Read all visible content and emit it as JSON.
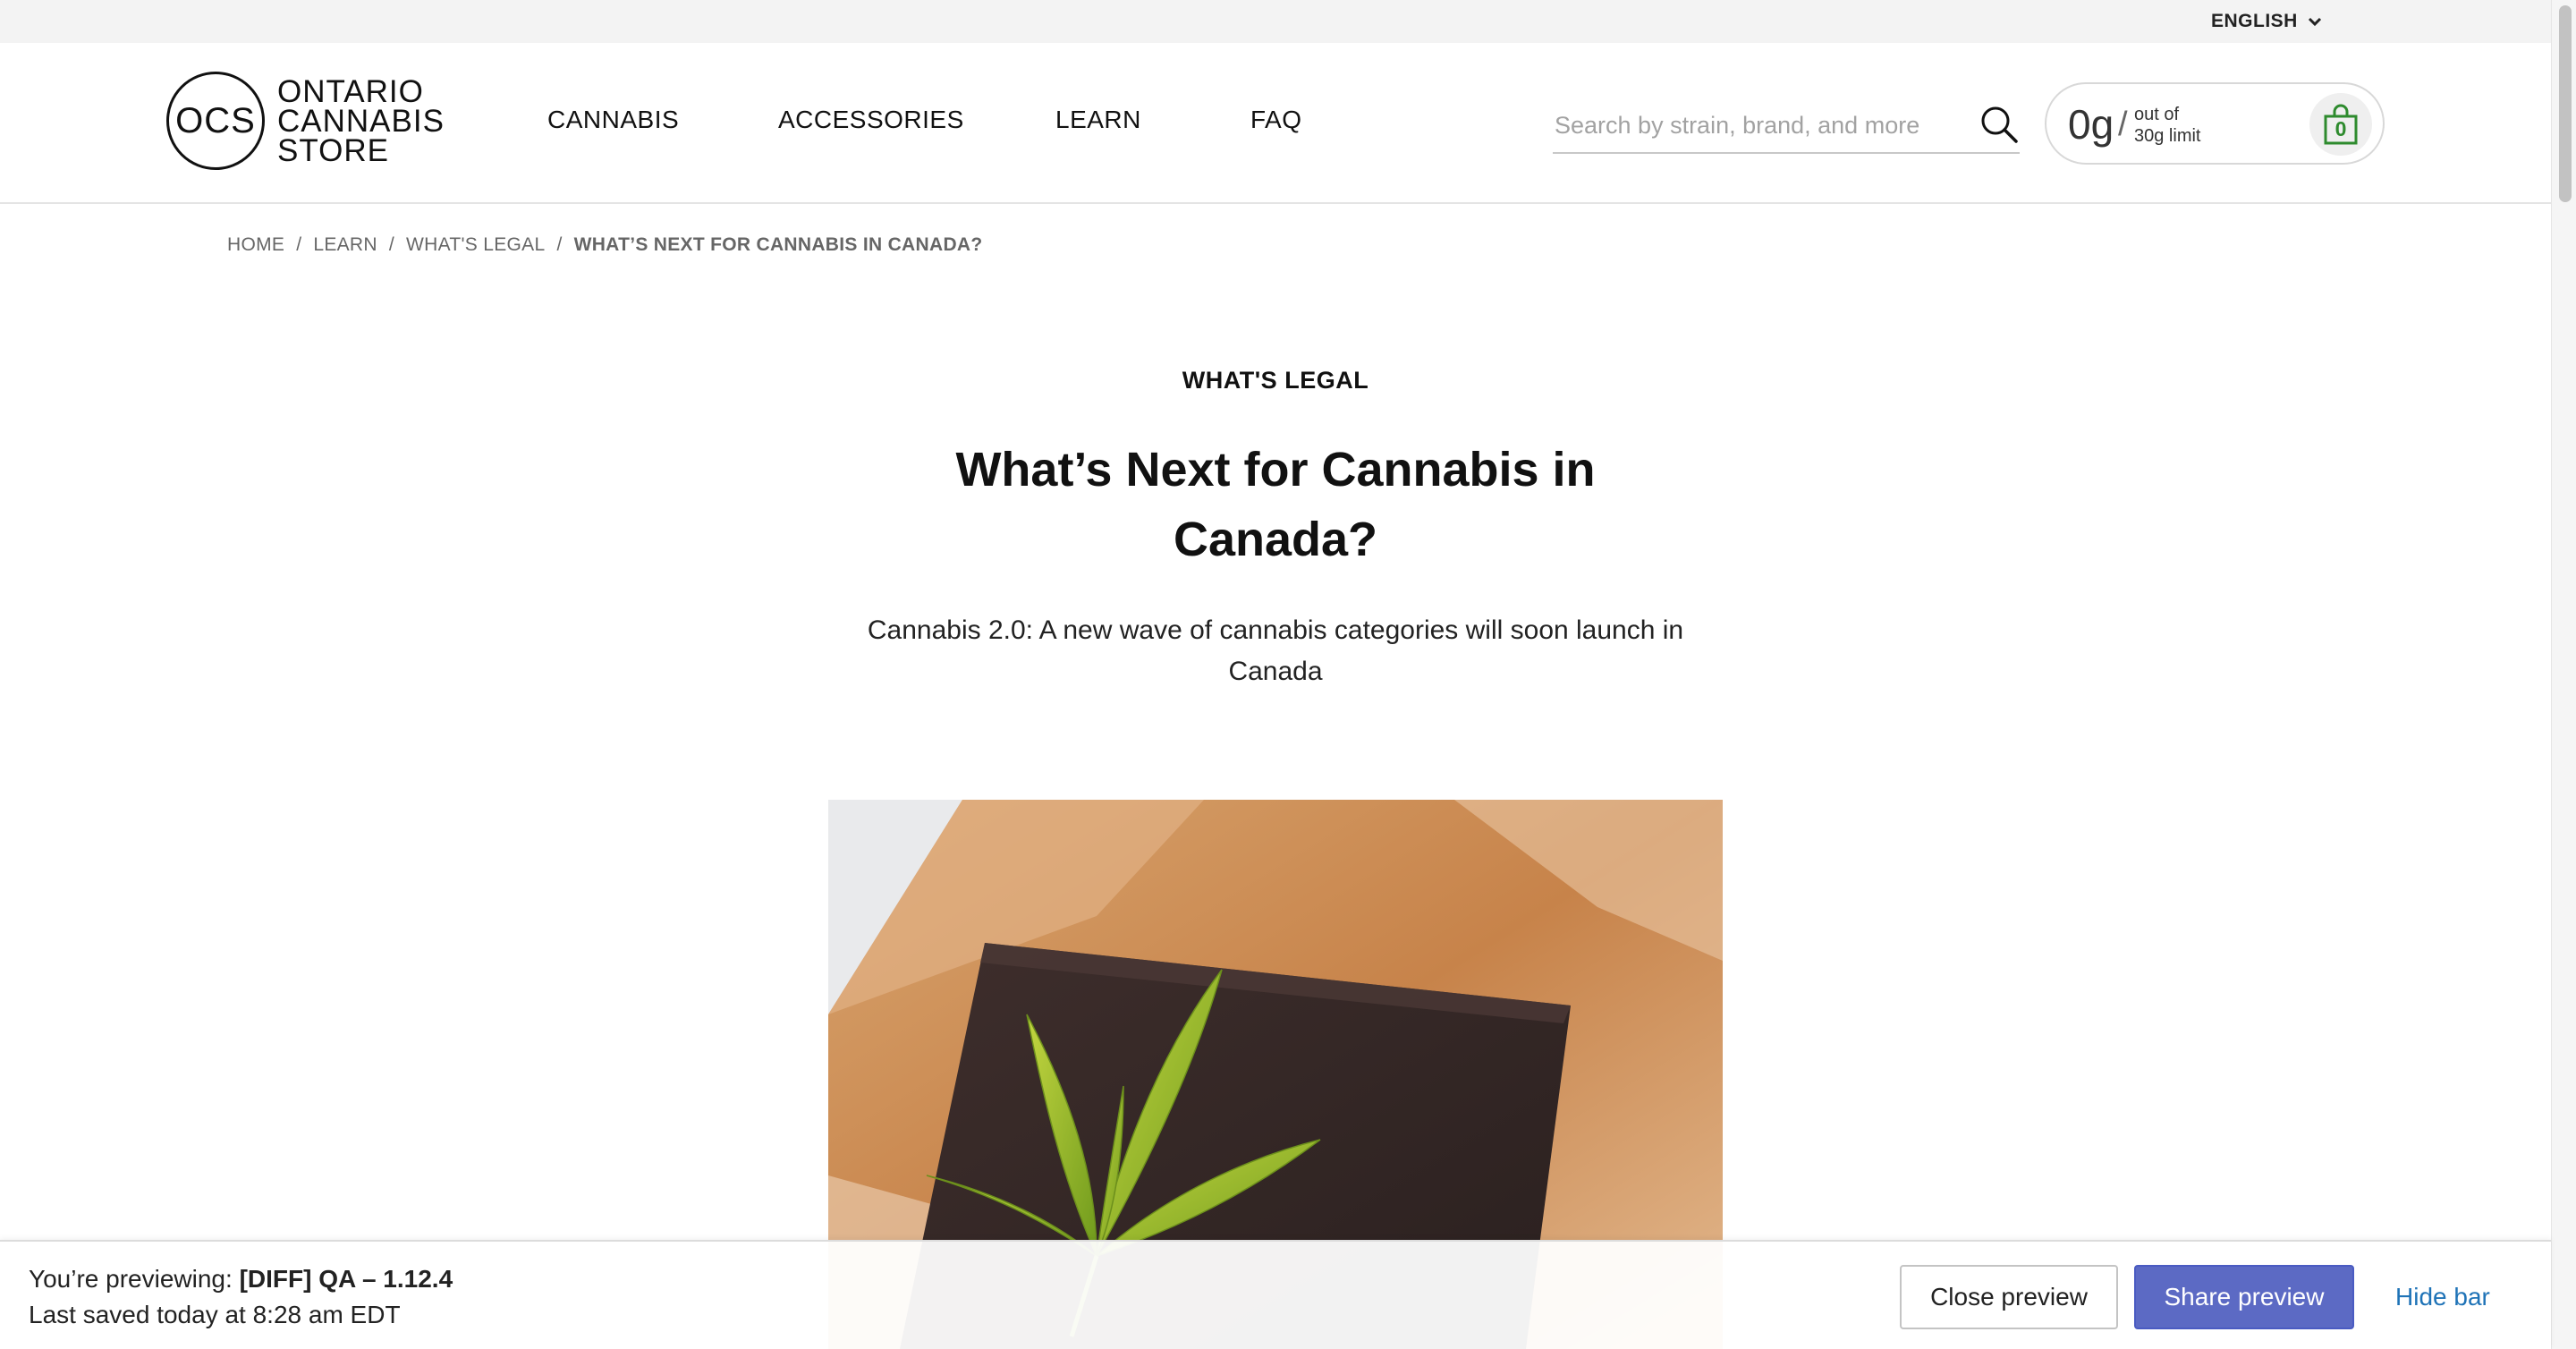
{
  "utility": {
    "language": "ENGLISH"
  },
  "header": {
    "logo": {
      "monogram": "OCS",
      "line1": "ONTARIO",
      "line2": "CANNABIS",
      "line3": "STORE"
    },
    "nav": [
      {
        "label": "CANNABIS"
      },
      {
        "label": "ACCESSORIES"
      },
      {
        "label": "LEARN"
      },
      {
        "label": "FAQ"
      }
    ],
    "search": {
      "placeholder": "Search by strain, brand, and more",
      "value": "",
      "icon": "search-icon"
    },
    "cart": {
      "amount": "0g",
      "slash": "/",
      "limit_line1": "out of",
      "limit_line2": "30g limit",
      "count": "0",
      "icon": "shopping-bag-icon",
      "accent_color": "#2e8b2e"
    }
  },
  "breadcrumb": {
    "items": [
      {
        "label": "HOME"
      },
      {
        "label": "LEARN"
      },
      {
        "label": "WHAT'S LEGAL"
      }
    ],
    "separator": "/",
    "current": "WHAT’S NEXT FOR CANNABIS IN CANADA?"
  },
  "article": {
    "category": "WHAT'S LEGAL",
    "title": "What’s Next for Cannabis in Canada?",
    "subtitle": "Cannabis 2.0: A new wave of cannabis categories will soon launch in Canada",
    "hero_image": "chocolate-bar-with-cannabis-leaf"
  },
  "preview_bar": {
    "prefix": "You’re previewing:",
    "theme_name": "[DIFF] QA – 1.12.4",
    "saved_text": "Last saved today at 8:28 am EDT",
    "close_label": "Close preview",
    "share_label": "Share preview",
    "hide_label": "Hide bar",
    "share_color": "#5c6ac4",
    "link_color": "#1f73b7"
  }
}
